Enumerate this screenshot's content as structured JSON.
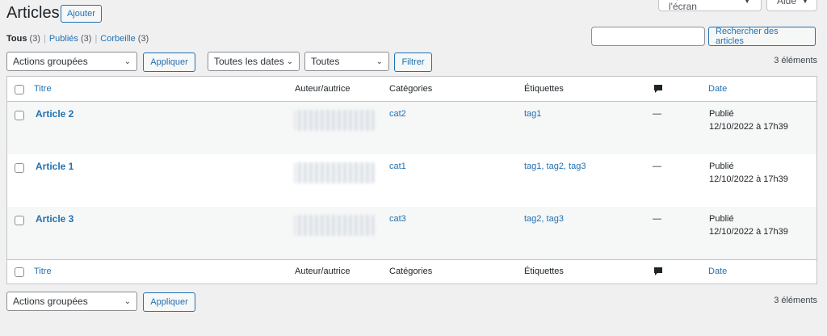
{
  "screen_tabs": {
    "screen_options": "Options de l'écran",
    "help": "Aide"
  },
  "header": {
    "title": "Articles",
    "add_new": "Ajouter"
  },
  "views": {
    "all": "Tous",
    "all_count": "(3)",
    "published": "Publiés",
    "published_count": "(3)",
    "trash": "Corbeille",
    "trash_count": "(3)",
    "separator": "|"
  },
  "search": {
    "value": "",
    "button": "Rechercher des articles"
  },
  "top_nav": {
    "bulk_actions": "Actions groupées",
    "apply": "Appliquer",
    "dates": "Toutes les dates",
    "categories": "Toutes",
    "filter": "Filtrer",
    "count": "3 éléments"
  },
  "columns": {
    "title": "Titre",
    "author": "Auteur/autrice",
    "categories": "Catégories",
    "tags": "Étiquettes",
    "comments_icon": "comment-icon",
    "date": "Date"
  },
  "rows": [
    {
      "title": "Article 2",
      "category": "cat2",
      "tags": "tag1",
      "comments": "—",
      "status": "Publié",
      "date": "12/10/2022 à 17h39"
    },
    {
      "title": "Article 1",
      "category": "cat1",
      "tags": "tag1, tag2, tag3",
      "comments": "—",
      "status": "Publié",
      "date": "12/10/2022 à 17h39"
    },
    {
      "title": "Article 3",
      "category": "cat3",
      "tags": "tag2, tag3",
      "comments": "—",
      "status": "Publié",
      "date": "12/10/2022 à 17h39"
    }
  ],
  "bottom_nav": {
    "bulk_actions": "Actions groupées",
    "apply": "Appliquer",
    "count": "3 éléments"
  },
  "colors": {
    "link": "#2271b1",
    "background": "#f0f0f1",
    "alt_row": "#f6f7f7"
  }
}
